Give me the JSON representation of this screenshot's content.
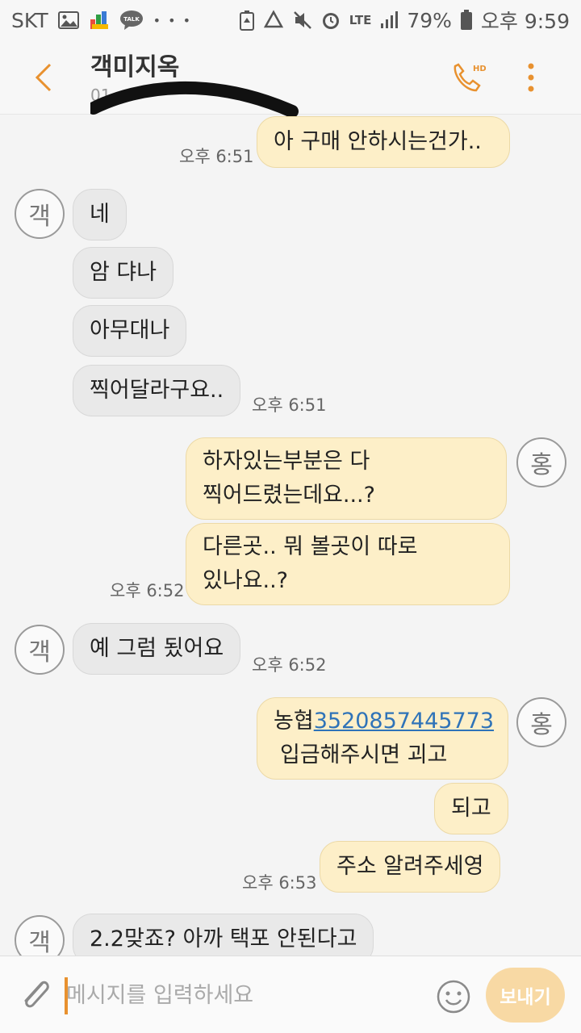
{
  "status_bar": {
    "carrier": "SKT",
    "network": "LTE",
    "battery": "79%",
    "time": "오후 9:59",
    "icons": [
      "image-icon",
      "app-icon",
      "talk-icon",
      "more-notifications-icon",
      "battery-saver-icon",
      "recycle-icon",
      "mute-icon",
      "alarm-icon",
      "lte-icon",
      "signal-icon",
      "battery-icon"
    ],
    "talk_label": "TALK",
    "dots": "• • •"
  },
  "header": {
    "title": "객미지옥",
    "subtitle": "01",
    "call_label": "HD"
  },
  "messages": [
    {
      "side": "out",
      "text": "아 구매 안하시는건가..",
      "time": "오후 6:51"
    },
    {
      "side": "in",
      "avatar": "객",
      "text": "네"
    },
    {
      "side": "in",
      "text": "암 댜나"
    },
    {
      "side": "in",
      "text": "아무대나"
    },
    {
      "side": "in",
      "text": "찍어달라구요..",
      "time": "오후 6:51"
    },
    {
      "side": "out",
      "avatar": "홍",
      "lines": [
        "하자있는부분은 다",
        "찍어드렸는데요...?"
      ]
    },
    {
      "side": "out",
      "lines": [
        "다른곳.. 뭐 볼곳이 따로",
        "있나요..?"
      ],
      "time": "오후 6:52"
    },
    {
      "side": "in",
      "avatar": "객",
      "text": "예 그럼 됬어요",
      "time": "오후 6:52"
    },
    {
      "side": "out",
      "avatar": "홍",
      "bank": "농협",
      "account": "3520857445773",
      "line2": "입금해주시면 괴고"
    },
    {
      "side": "out",
      "text": "되고"
    },
    {
      "side": "out",
      "text": "주소 알려주세영",
      "time": "오후 6:53"
    },
    {
      "side": "in",
      "avatar": "객",
      "text": "2.2맞죠? 아까 택포 안된다고"
    }
  ],
  "composer": {
    "placeholder": "메시지를 입력하세요",
    "send_label": "보내기"
  }
}
